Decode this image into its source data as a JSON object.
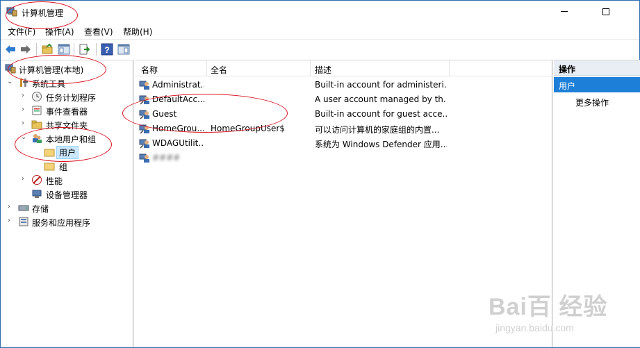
{
  "window": {
    "title": "计算机管理"
  },
  "menu": [
    "文件(F)",
    "操作(A)",
    "查看(V)",
    "帮助(H)"
  ],
  "toolbar": [
    "back-icon",
    "forward-icon",
    "up-folder-icon",
    "show-hide-tree-icon",
    "export-list-icon",
    "help-icon",
    "show-hide-action-pane-icon"
  ],
  "tree": {
    "root": "计算机管理(本地)",
    "system_tools": "系统工具",
    "task_scheduler": "任务计划程序",
    "event_viewer": "事件查看器",
    "shared_folders": "共享文件夹",
    "local_users_groups": "本地用户和组",
    "users": "用户",
    "groups": "组",
    "performance": "性能",
    "device_manager": "设备管理器",
    "storage": "存储",
    "services_apps": "服务和应用程序"
  },
  "list": {
    "columns": [
      "名称",
      "全名",
      "描述"
    ],
    "rows": [
      {
        "name": "Administrat...",
        "fullname": "",
        "desc": "Built-in account for administeri..."
      },
      {
        "name": "DefaultAcc...",
        "fullname": "",
        "desc": "A user account managed by th..."
      },
      {
        "name": "Guest",
        "fullname": "",
        "desc": "Built-in account for guest acce..."
      },
      {
        "name": "HomeGrou...",
        "fullname": "HomeGroupUser$",
        "desc": "可以访问计算机的家庭组的内置..."
      },
      {
        "name": "WDAGUtilit...",
        "fullname": "",
        "desc": "系统为 Windows Defender 应用..."
      },
      {
        "name": "####",
        "fullname": "",
        "desc": ""
      }
    ]
  },
  "actions": {
    "header": "操作",
    "section": "用户",
    "more": "更多操作"
  },
  "watermark": {
    "logo": "Bai百 经验",
    "url": "jingyan.baidu.com"
  },
  "colors": {
    "selection": "#cce8ff",
    "action_highlight": "#1e7fd8",
    "annotation": "#d9121f"
  }
}
